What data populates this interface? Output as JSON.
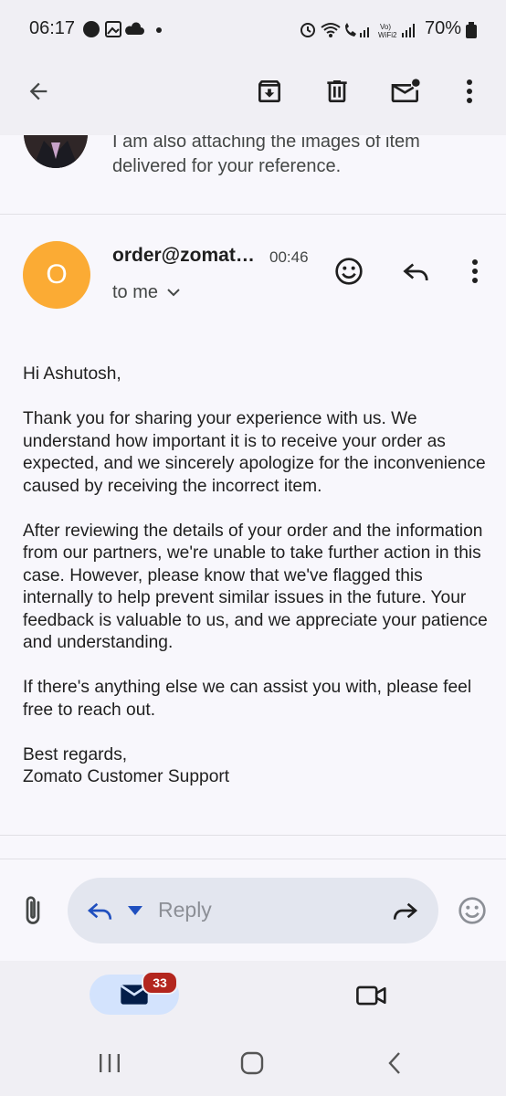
{
  "status_bar": {
    "time": "06:17",
    "network_label": "Vo) WiFi2",
    "battery": "70%"
  },
  "toolbar": {
    "icons": [
      "back-arrow-icon",
      "archive-icon",
      "delete-icon",
      "mark-unread-icon",
      "more-vert-icon"
    ]
  },
  "previous_message": {
    "snippet": "I am also attaching the images of item delivered for your reference."
  },
  "message": {
    "avatar_letter": "O",
    "avatar_color": "#fbab34",
    "sender": "order@zomato.com",
    "time": "00:46",
    "recipient": "to me",
    "body": [
      "Hi Ashutosh,",
      "Thank you for sharing your experience with us. We understand how important it is to receive your order as expected, and we sincerely apologize for the inconvenience caused by receiving the incorrect item.",
      "After reviewing the details of your order and the information from our partners, we're unable to take further action in this case. However, please know that we've flagged this internally to help prevent similar issues in the future. Your feedback is valuable to us, and we appreciate your patience and understanding.",
      "If there's anything else we can assist you with, please feel free to reach out.",
      "Best regards,\nZomato Customer Support"
    ]
  },
  "reply_bar": {
    "placeholder": "Reply"
  },
  "bottom_nav": {
    "mail_badge": "33",
    "accent": "#d3e3fd",
    "badge_color": "#b3261e"
  }
}
